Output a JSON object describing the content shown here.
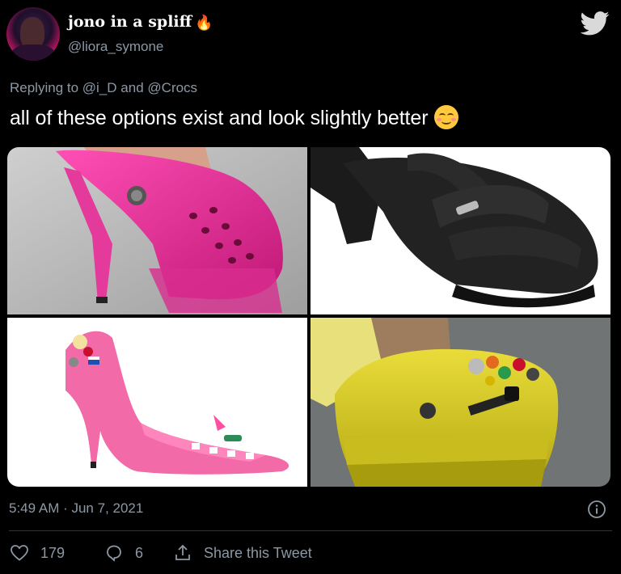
{
  "user": {
    "display_name": "jono in a spliff",
    "handle": "@liora_symone",
    "avatar_icon": "avatar-photo",
    "name_emoji": "🔥"
  },
  "reply": {
    "prefix": "Replying to",
    "mention_1": "@i_D",
    "joiner": "and",
    "mention_2": "@Crocs"
  },
  "tweet": {
    "text": "all of these options exist and look slightly better",
    "emoji": "smiling-face-with-smiling-eyes"
  },
  "media": [
    {
      "description_icon": "pink-heeled-clog-photo"
    },
    {
      "description_icon": "black-heeled-sandal-photo"
    },
    {
      "description_icon": "pink-stiletto-croc-photo"
    },
    {
      "description_icon": "yellow-platform-croc-photo"
    }
  ],
  "meta": {
    "timestamp": "5:49 AM · Jun 7, 2021"
  },
  "actions": {
    "like_count": "179",
    "reply_count": "6",
    "share_label": "Share this Tweet"
  },
  "colors": {
    "background": "#000000",
    "text_primary": "#ffffff",
    "text_secondary": "#8b98a5",
    "twitter_blue": "#d9d9d9"
  }
}
